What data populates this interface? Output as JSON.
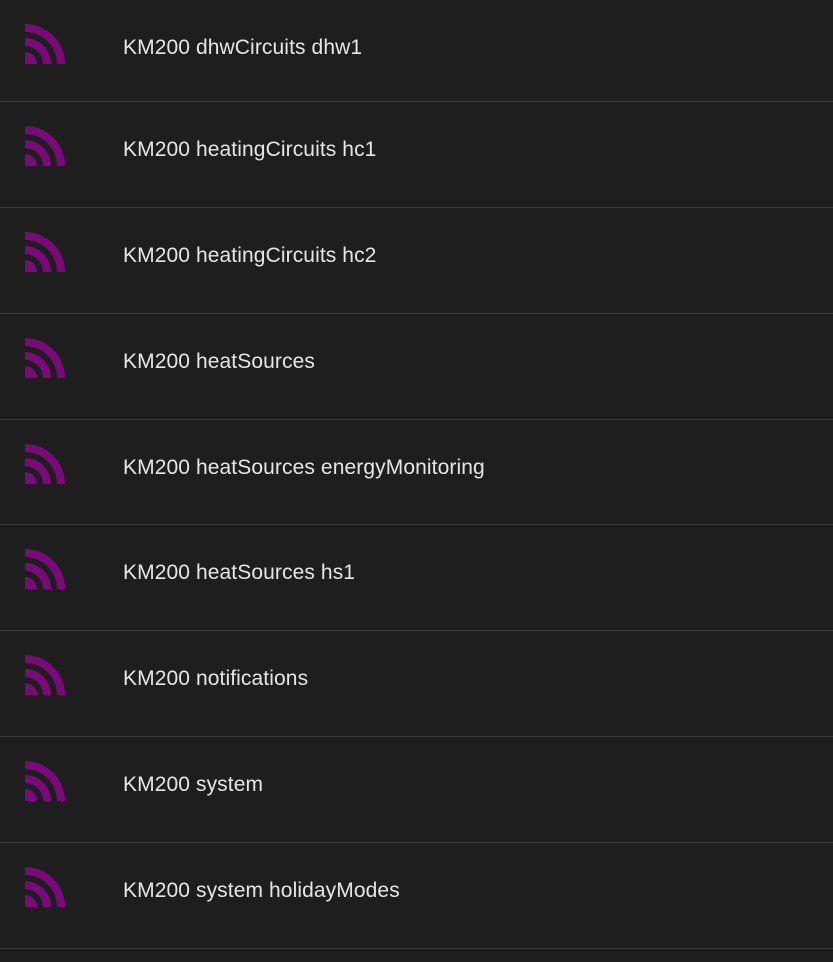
{
  "icon": {
    "name": "rss-feed-icon",
    "color": "#7a0a7a"
  },
  "items": [
    {
      "label": "KM200 dhwCircuits dhw1"
    },
    {
      "label": "KM200 heatingCircuits hc1"
    },
    {
      "label": "KM200 heatingCircuits hc2"
    },
    {
      "label": "KM200 heatSources"
    },
    {
      "label": "KM200 heatSources energyMonitoring"
    },
    {
      "label": "KM200 heatSources hs1"
    },
    {
      "label": "KM200 notifications"
    },
    {
      "label": "KM200 system"
    },
    {
      "label": "KM200 system holidayModes"
    }
  ]
}
